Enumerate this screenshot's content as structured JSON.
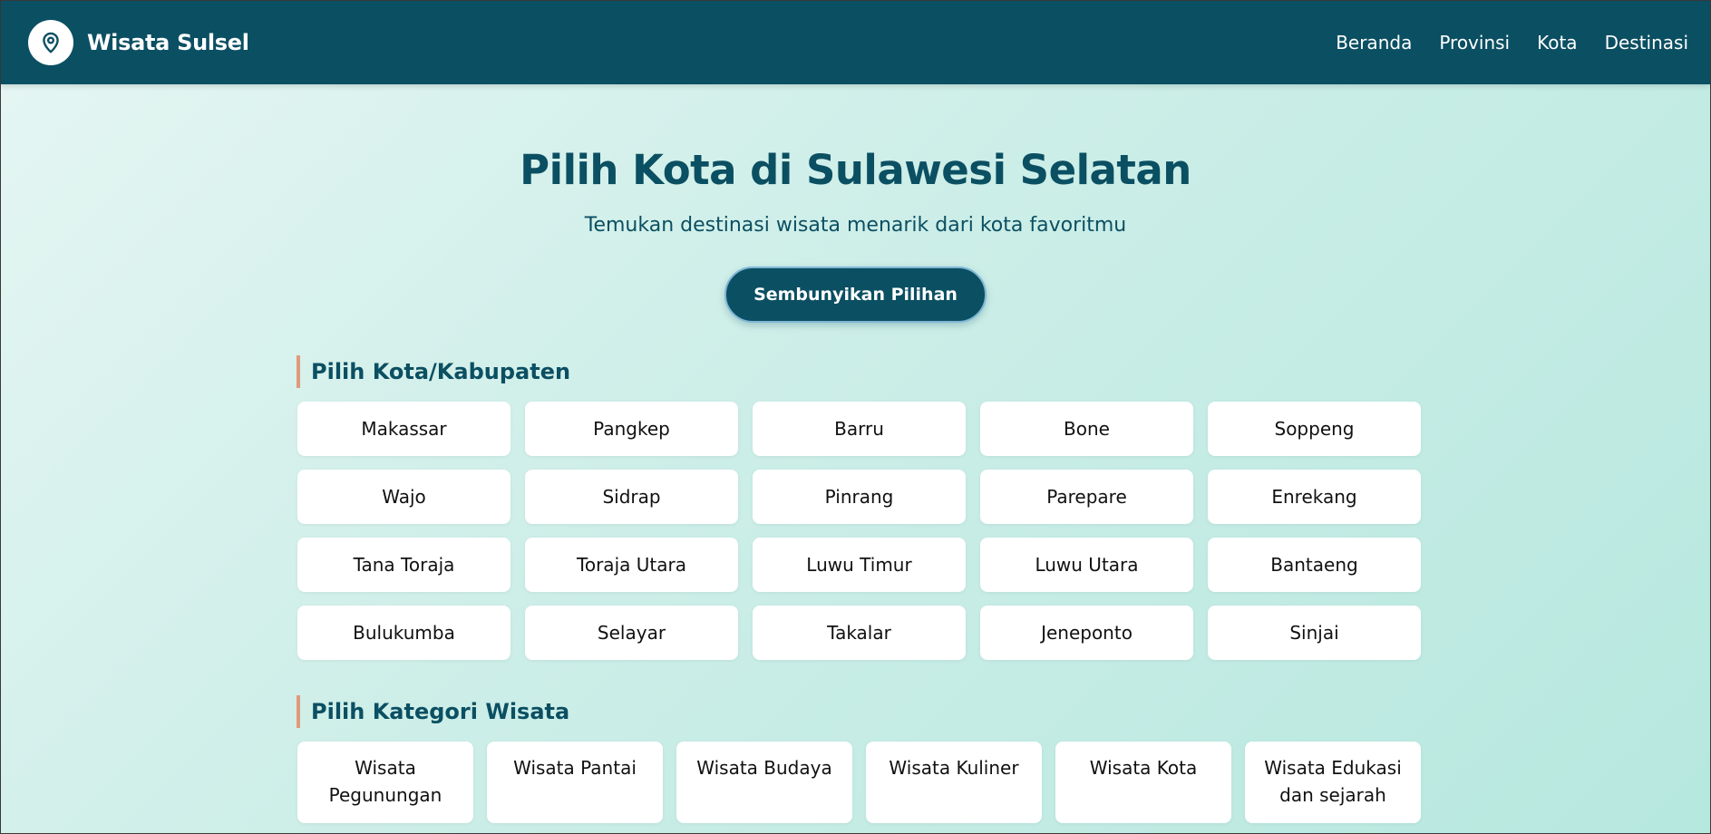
{
  "brand": {
    "name": "Wisata Sulsel",
    "logo_icon": "map-pin-icon"
  },
  "nav": [
    {
      "label": "Beranda"
    },
    {
      "label": "Provinsi"
    },
    {
      "label": "Kota"
    },
    {
      "label": "Destinasi"
    }
  ],
  "hero": {
    "title": "Pilih Kota di Sulawesi Selatan",
    "subtitle": "Temukan destinasi wisata menarik dari kota favoritmu",
    "toggle_button": "Sembunyikan Pilihan"
  },
  "city_section": {
    "heading": "Pilih Kota/Kabupaten",
    "cities": [
      "Makassar",
      "Pangkep",
      "Barru",
      "Bone",
      "Soppeng",
      "Wajo",
      "Sidrap",
      "Pinrang",
      "Parepare",
      "Enrekang",
      "Tana Toraja",
      "Toraja Utara",
      "Luwu Timur",
      "Luwu Utara",
      "Bantaeng",
      "Bulukumba",
      "Selayar",
      "Takalar",
      "Jeneponto",
      "Sinjai"
    ]
  },
  "category_section": {
    "heading": "Pilih Kategori Wisata",
    "categories": [
      "Wisata Pegunungan",
      "Wisata Pantai",
      "Wisata Budaya",
      "Wisata Kuliner",
      "Wisata Kota",
      "Wisata Edukasi dan sejarah"
    ]
  },
  "colors": {
    "primary": "#0b4f62",
    "accent": "#e09a7b",
    "card": "#ffffff"
  }
}
